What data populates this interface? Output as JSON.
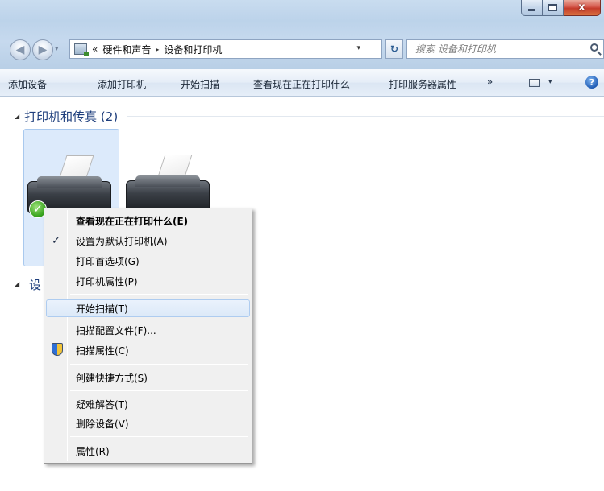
{
  "window": {
    "close_glyph": "x"
  },
  "address_bar": {
    "chevron": "«",
    "segments": [
      "硬件和声音",
      "设备和打印机"
    ],
    "separator": "▸",
    "dropdown_glyph": "▾",
    "refresh_glyph": "↻"
  },
  "search": {
    "placeholder": "搜索 设备和打印机"
  },
  "command_bar": {
    "items": [
      "添加设备",
      "添加打印机",
      "开始扫描",
      "查看现在正在打印什么",
      "打印服务器属性"
    ],
    "more_glyph": "»",
    "view_drop_glyph": "▾",
    "help_glyph": "?"
  },
  "groups": {
    "printers_title": "打印机和传真 (2)",
    "devices_title_partial": "设",
    "collapse_glyph": "◢"
  },
  "devices": {
    "default_check_glyph": "✓"
  },
  "context_menu": {
    "items": [
      {
        "label": "查看现在正在打印什么(E)",
        "bold": true
      },
      {
        "label": "设置为默认打印机(A)",
        "checked": true
      },
      {
        "label": "打印首选项(G)"
      },
      {
        "label": "打印机属性(P)"
      },
      {
        "label": "开始扫描(T)",
        "hover": true
      },
      {
        "label": "扫描配置文件(F)..."
      },
      {
        "label": "扫描属性(C)",
        "icon": "uac-shield-icon"
      },
      {
        "label": "创建快捷方式(S)"
      },
      {
        "label": "疑难解答(T)"
      },
      {
        "label": "删除设备(V)"
      },
      {
        "label": "属性(R)"
      }
    ],
    "check_glyph": "✓"
  },
  "colors": {
    "title_bar": "#c6d9ee",
    "selection_tile": "#dceafb",
    "group_title": "#1e3e7c",
    "close_button": "#c43b2b"
  }
}
